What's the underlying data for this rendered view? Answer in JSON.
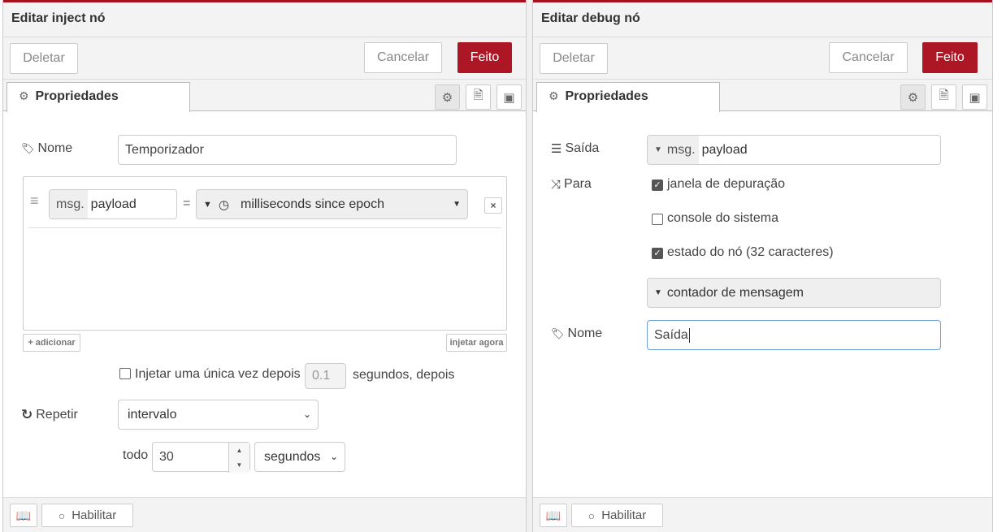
{
  "left": {
    "title": "Editar inject nó",
    "delete_label": "Deletar",
    "cancel_label": "Cancelar",
    "done_label": "Feito",
    "tab_label": "Propriedades",
    "name_label": "Nome",
    "name_value": "Temporizador",
    "prop_prefix": "msg.",
    "prop_value": "payload",
    "equals": "=",
    "type_value": "milliseconds since epoch",
    "add_label": "adicionar",
    "inject_now_label": "injetar agora",
    "once_label": "Injetar uma única vez depois",
    "once_value": "0.1",
    "seconds_after_label": "segundos, depois",
    "repeat_label": "Repetir",
    "repeat_value": "intervalo",
    "every_label": "todo",
    "every_value": "30",
    "unit_value": "segundos",
    "enable_label": "Habilitar"
  },
  "right": {
    "title": "Editar debug nó",
    "delete_label": "Deletar",
    "cancel_label": "Cancelar",
    "done_label": "Feito",
    "tab_label": "Propriedades",
    "output_label": "Saída",
    "output_prefix": "msg.",
    "output_value": "payload",
    "to_label": "Para",
    "opt_debug": "janela de depuração",
    "opt_console": "console do sistema",
    "opt_status": "estado do nó (32 caracteres)",
    "status_select_value": "contador de mensagem",
    "name_label": "Nome",
    "name_value": "Saída",
    "enable_label": "Habilitar"
  },
  "colors": {
    "accent": "#ad1625",
    "topbar": "#a6101d"
  }
}
